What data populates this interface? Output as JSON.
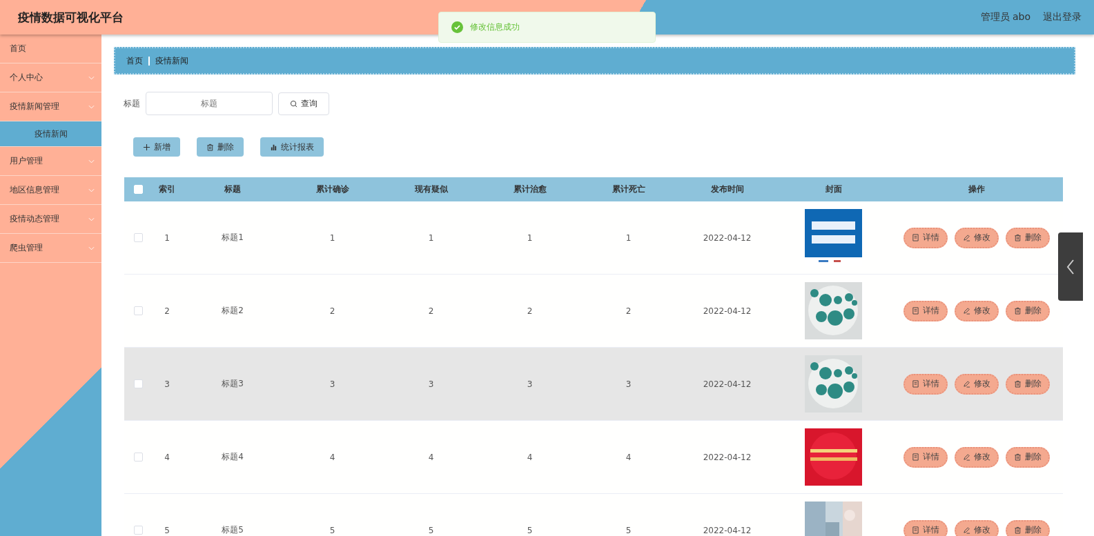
{
  "header": {
    "title": "疫情数据可视化平台",
    "user": "管理员 abo",
    "logout": "退出登录"
  },
  "toast": {
    "message": "修改信息成功"
  },
  "sidebar": {
    "items": [
      {
        "kind": "link",
        "label": "首页",
        "selected": false
      },
      {
        "kind": "group",
        "label": "个人中心",
        "selected": false
      },
      {
        "kind": "group",
        "label": "疫情新闻管理",
        "selected": false,
        "children": [
          {
            "label": "疫情新闻",
            "selected": true
          }
        ]
      },
      {
        "kind": "group",
        "label": "用户管理",
        "selected": false
      },
      {
        "kind": "group",
        "label": "地区信息管理",
        "selected": false
      },
      {
        "kind": "group",
        "label": "疫情动态管理",
        "selected": false
      },
      {
        "kind": "group",
        "label": "爬虫管理",
        "selected": false
      }
    ]
  },
  "breadcrumb": [
    "首页",
    "疫情新闻"
  ],
  "search": {
    "label": "标题",
    "placeholder": "标题",
    "button": "查询"
  },
  "toolbar": [
    {
      "kind": "add",
      "label": "新增"
    },
    {
      "kind": "delete",
      "label": "删除"
    },
    {
      "kind": "chart",
      "label": "统计报表"
    }
  ],
  "table": {
    "all_checked": false,
    "columns": [
      "索引",
      "标题",
      "累计确诊",
      "现有疑似",
      "累计治愈",
      "累计死亡",
      "发布时间",
      "封面",
      "操作"
    ],
    "rows": [
      {
        "checked": false,
        "highlighted": false,
        "cells": [
          "1",
          "标题1",
          "1",
          "1",
          "1",
          "1",
          "2022-04-12"
        ],
        "cover": {
          "kind": "blue-banner"
        },
        "actions": [
          {
            "kind": "detail",
            "label": "详情"
          },
          {
            "kind": "edit",
            "label": "修改"
          },
          {
            "kind": "delete",
            "label": "删除"
          }
        ]
      },
      {
        "checked": false,
        "highlighted": false,
        "cells": [
          "2",
          "标题2",
          "2",
          "2",
          "2",
          "2",
          "2022-04-12"
        ],
        "cover": {
          "kind": "icons"
        },
        "actions": [
          {
            "kind": "detail",
            "label": "详情"
          },
          {
            "kind": "edit",
            "label": "修改"
          },
          {
            "kind": "delete",
            "label": "删除"
          }
        ]
      },
      {
        "checked": false,
        "highlighted": true,
        "cells": [
          "3",
          "标题3",
          "3",
          "3",
          "3",
          "3",
          "2022-04-12"
        ],
        "cover": {
          "kind": "icons"
        },
        "actions": [
          {
            "kind": "detail",
            "label": "详情"
          },
          {
            "kind": "edit",
            "label": "修改"
          },
          {
            "kind": "delete",
            "label": "删除"
          }
        ]
      },
      {
        "checked": false,
        "highlighted": false,
        "cells": [
          "4",
          "标题4",
          "4",
          "4",
          "4",
          "4",
          "2022-04-12"
        ],
        "cover": {
          "kind": "red-banner"
        },
        "actions": [
          {
            "kind": "detail",
            "label": "详情"
          },
          {
            "kind": "edit",
            "label": "修改"
          },
          {
            "kind": "delete",
            "label": "删除"
          }
        ]
      },
      {
        "checked": false,
        "highlighted": false,
        "cells": [
          "5",
          "标题5",
          "5",
          "5",
          "5",
          "5",
          "2022-04-12"
        ],
        "actions": [
          {
            "kind": "detail",
            "label": "详情"
          },
          {
            "kind": "edit",
            "label": "修改"
          },
          {
            "kind": "delete",
            "label": "删除"
          }
        ]
      }
    ]
  }
}
